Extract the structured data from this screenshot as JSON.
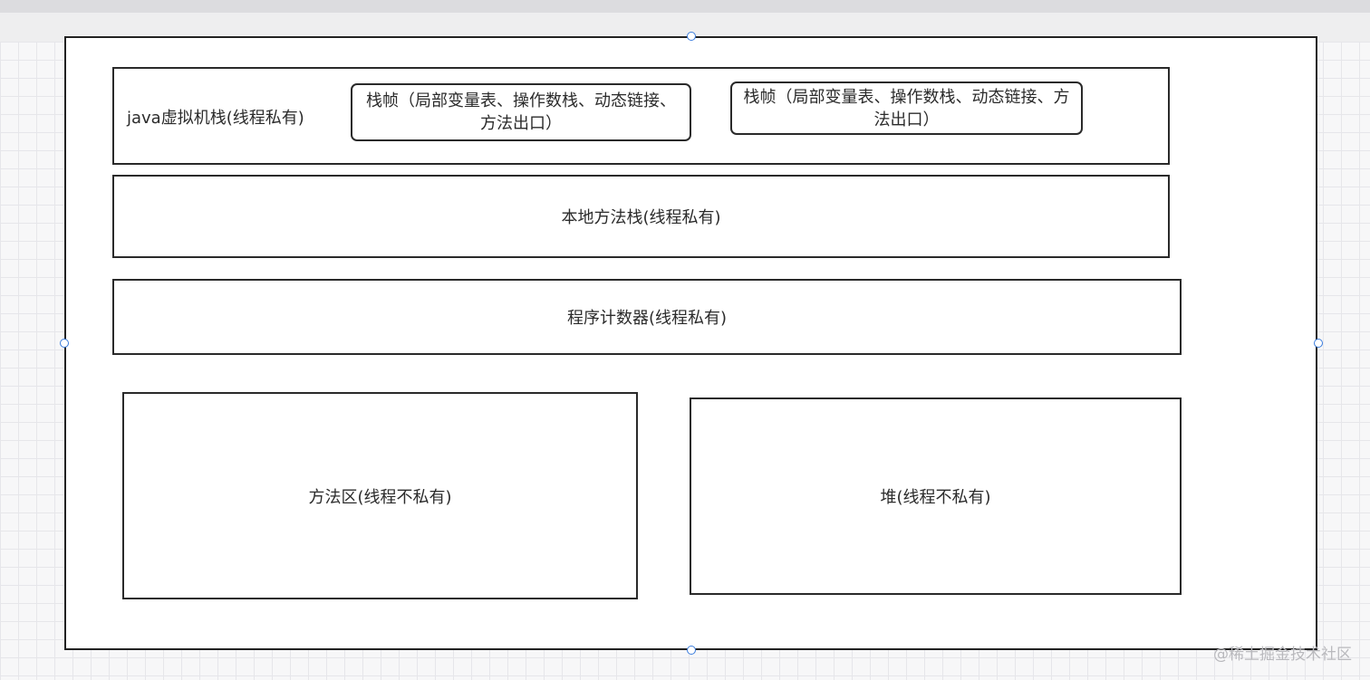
{
  "diagram": {
    "jvm_stack": {
      "label": "java虚拟机栈(线程私有)",
      "frames": [
        "栈帧（局部变量表、操作数栈、动态链接、方法出口）",
        "栈帧（局部变量表、操作数栈、动态链接、方法出口）"
      ]
    },
    "native_method_stack": "本地方法栈(线程私有)",
    "program_counter": "程序计数器(线程私有)",
    "method_area": "方法区(线程不私有)",
    "heap": "堆(线程不私有)"
  },
  "watermark": "@稀土掘金技术社区",
  "colors": {
    "stroke": "#2a2a2a",
    "handle": "#3b7ddd",
    "grid": "#e6e6ea"
  }
}
